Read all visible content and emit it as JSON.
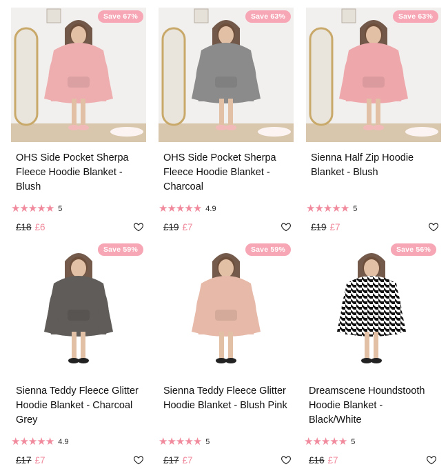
{
  "products": [
    {
      "badge": "Save 67%",
      "title": "OHS Side Pocket Sherpa Fleece Hoodie Blanket - Blush",
      "rating": "5",
      "old_price": "£18",
      "new_price": "£6",
      "hoodie_color": "#eeaeb0",
      "bg": "#f2f0ee",
      "floor": "#d9c7ad"
    },
    {
      "badge": "Save 63%",
      "title": "OHS Side Pocket Sherpa Fleece Hoodie Blanket - Charcoal",
      "rating": "4.9",
      "old_price": "£19",
      "new_price": "£7",
      "hoodie_color": "#8b8b8b",
      "bg": "#f2f0ee",
      "floor": "#d9c7ad"
    },
    {
      "badge": "Save 63%",
      "title": "Sienna Half Zip Hoodie Blanket - Blush",
      "rating": "5",
      "old_price": "£19",
      "new_price": "£7",
      "hoodie_color": "#eea8ab",
      "bg": "#f2f0ee",
      "floor": "#d9c7ad"
    },
    {
      "badge": "Save 59%",
      "title": "Sienna Teddy Fleece Glitter Hoodie Blanket - Charcoal Grey",
      "rating": "4.9",
      "old_price": "£17",
      "new_price": "£7",
      "hoodie_color": "#5f5c59",
      "bg": "#ffffff",
      "floor": "#ffffff"
    },
    {
      "badge": "Save 59%",
      "title": "Sienna Teddy Fleece Glitter Hoodie Blanket - Blush Pink",
      "rating": "5",
      "old_price": "£17",
      "new_price": "£7",
      "hoodie_color": "#e6b9a8",
      "bg": "#ffffff",
      "floor": "#ffffff"
    },
    {
      "badge": "Save 56%",
      "title": "Dreamscene Houndstooth Hoodie Blanket - Black/White",
      "rating": "5",
      "old_price": "£16",
      "new_price": "£7",
      "hoodie_color": "houndstooth",
      "bg": "#ffffff",
      "floor": "#ffffff"
    }
  ],
  "icons": {
    "star": "star-icon",
    "heart": "heart-icon"
  },
  "colors": {
    "accent": "#f08a9c",
    "badge": "#f6a6b4"
  }
}
